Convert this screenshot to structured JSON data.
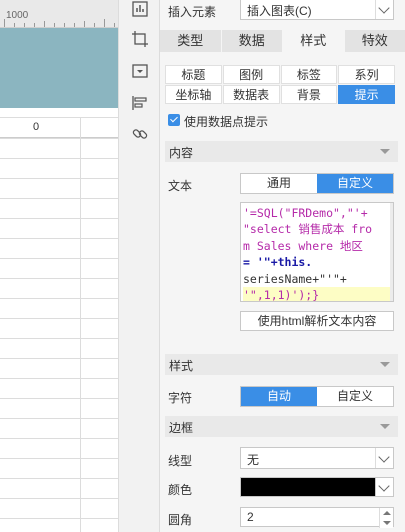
{
  "ruler": {
    "label": "1000"
  },
  "sheet": {
    "column_value": "0"
  },
  "panel": {
    "insert_element_label": "插入元素",
    "insert_chart_select": "插入图表(C)",
    "tabs": [
      "类型",
      "数据",
      "样式",
      "特效"
    ],
    "active_tab": "样式",
    "subtabs_row1": [
      "标题",
      "图例",
      "标签",
      "系列"
    ],
    "subtabs_row2": [
      "坐标轴",
      "数据表",
      "背景",
      "提示"
    ],
    "active_subtab": "提示",
    "use_tooltip_label": "使用数据点提示",
    "section_content": "内容",
    "text_label": "文本",
    "text_modes": [
      "通用",
      "自定义"
    ],
    "active_text_mode": "自定义",
    "code_lines": [
      "'=SQL(\"FRDemo\",\"'+",
      "\"select 销售成本 fro",
      "m Sales where 地区",
      "= '\"+this.",
      "seriesName+\"'\"+",
      "'\",1,1)');}"
    ],
    "html_parse_button": "使用html解析文本内容",
    "section_style": "样式",
    "char_label": "字符",
    "char_modes": [
      "自动",
      "自定义"
    ],
    "active_char_mode": "自动",
    "section_border": "边框",
    "line_type_label": "线型",
    "line_type_value": "无",
    "color_label": "颜色",
    "color_value": "#000000",
    "radius_label": "圆角",
    "radius_value": "2"
  },
  "colors": {
    "accent": "#3a8ee6",
    "chart_band": "#8bb5c0"
  }
}
